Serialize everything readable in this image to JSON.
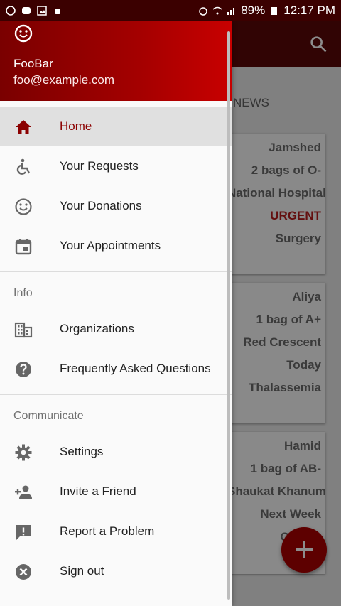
{
  "status": {
    "battery": "89%",
    "time": "12:17 PM"
  },
  "drawer": {
    "user_name": "FooBar",
    "user_email": "foo@example.com",
    "items": [
      {
        "label": "Home",
        "icon": "home-icon",
        "active": true
      },
      {
        "label": "Your Requests",
        "icon": "accessible-icon"
      },
      {
        "label": "Your Donations",
        "icon": "smile-icon"
      },
      {
        "label": "Your Appointments",
        "icon": "calendar-icon"
      }
    ],
    "info_title": "Info",
    "info_items": [
      {
        "label": "Organizations",
        "icon": "building-icon"
      },
      {
        "label": "Frequently Asked Questions",
        "icon": "help-icon"
      }
    ],
    "communicate_title": "Communicate",
    "communicate_items": [
      {
        "label": "Settings",
        "icon": "gear-icon"
      },
      {
        "label": "Invite a Friend",
        "icon": "add-person-icon"
      },
      {
        "label": "Report a Problem",
        "icon": "feedback-icon"
      },
      {
        "label": "Sign out",
        "icon": "close-circle-icon"
      }
    ]
  },
  "background": {
    "news_label": "NEWS",
    "cards": [
      {
        "lines": [
          "Jamshed",
          "2 bags of O-",
          "National Hospital",
          "URGENT",
          "Surgery"
        ]
      },
      {
        "lines": [
          "Aliya",
          "1 bag of A+",
          "Red Crescent",
          "Today",
          "Thalassemia"
        ]
      },
      {
        "lines": [
          "Hamid",
          "1 bag of AB-",
          "Shaukat Khanum",
          "Next Week",
          "Cancer"
        ]
      }
    ]
  },
  "colors": {
    "primary": "#8b0000",
    "accent": "#b71c1c"
  }
}
